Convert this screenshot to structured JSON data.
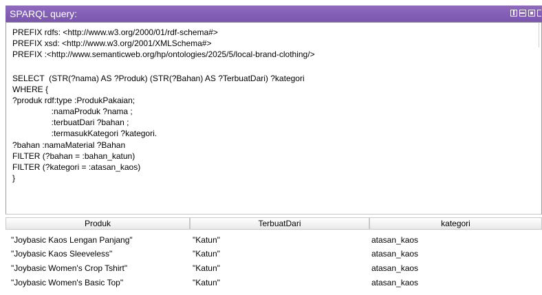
{
  "panel": {
    "title": "SPARQL query:"
  },
  "window_controls": {
    "icons": [
      "tile-icon",
      "split-rows-icon",
      "maximize-icon",
      "close-icon"
    ]
  },
  "query": {
    "lines": [
      "PREFIX rdfs: <http://www.w3.org/2000/01/rdf-schema#>",
      "PREFIX xsd: <http://www.w3.org/2001/XMLSchema#>",
      "PREFIX :<http://www.semanticweb.org/hp/ontologies/2025/5/local-brand-clothing/>",
      "",
      "SELECT  (STR(?nama) AS ?Produk) (STR(?Bahan) AS ?TerbuatDari) ?kategori",
      "WHERE {",
      "?produk rdf:type :ProdukPakaian;",
      "                 :namaProduk ?nama ;",
      "                 :terbuatDari ?bahan ;",
      "                 :termasukKategori ?kategori.",
      "?bahan :namaMaterial ?Bahan",
      "FILTER (?bahan = :bahan_katun)",
      "FILTER (?kategori = :atasan_kaos)",
      "}"
    ]
  },
  "results": {
    "columns": [
      "Produk",
      "TerbuatDari",
      "kategori"
    ],
    "rows": [
      [
        "\"Joybasic Kaos Lengan Panjang\"",
        "\"Katun\"",
        "atasan_kaos"
      ],
      [
        "\"Joybasic Kaos Sleeveless\"",
        "\"Katun\"",
        "atasan_kaos"
      ],
      [
        "\"Joybasic Women's Crop Tshirt\"",
        "\"Katun\"",
        "atasan_kaos"
      ],
      [
        "\"Joybasic Women's Basic Top\"",
        "\"Katun\"",
        "atasan_kaos"
      ]
    ]
  }
}
